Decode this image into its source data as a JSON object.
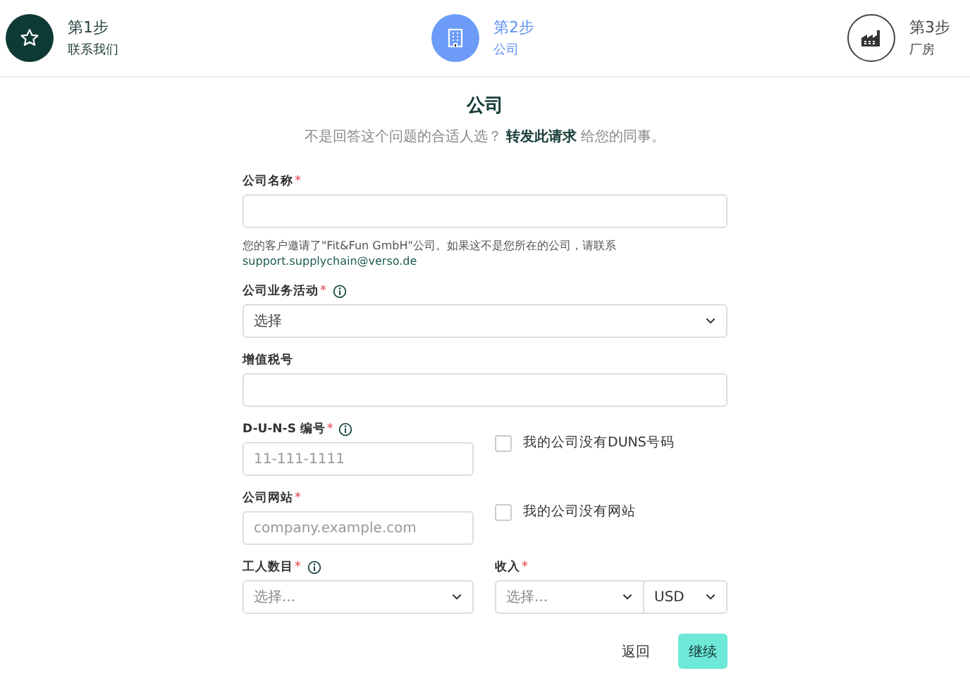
{
  "steps": [
    {
      "title": "第1步",
      "name": "联系我们",
      "completed": true,
      "selected": false
    },
    {
      "title": "第2步",
      "name": "公司",
      "completed": false,
      "selected": true
    },
    {
      "title": "第3步",
      "name": "厂房",
      "completed": false,
      "selected": false
    }
  ],
  "form": {
    "title": "公司",
    "subtitle": {
      "before": "不是回答这个问题的合适人选？",
      "link": "转发此请求",
      "after": "给您的同事。"
    },
    "fields": [
      {
        "kind": "text",
        "label": "公司名称",
        "required_mark": "*",
        "info": false,
        "note": "您的客户邀请了\"Fit&Fun GmbH\"公司。如果这不是您所在的公司，请联系",
        "note_link": "support.supplychain@verso.de"
      },
      {
        "kind": "select",
        "label": "公司业务活动",
        "required_mark": "*",
        "info": true,
        "value": "选择"
      },
      {
        "kind": "text",
        "label": "增值税号",
        "info": false
      },
      {
        "kind": "text_check",
        "label": "D-U-N-S 编号",
        "required_mark": "*",
        "info": true,
        "placeholder": "11-111-1111",
        "checkbox": {
          "label": "我的公司没有DUNS号码",
          "checked": false
        }
      },
      {
        "kind": "text_check",
        "label": "公司网站",
        "required_mark": "*",
        "info": false,
        "placeholder": "company.example.com",
        "checkbox": {
          "label": "我的公司没有网站",
          "checked": false
        }
      },
      {
        "kind": "select_pair",
        "left": {
          "label": "工人数目",
          "required_mark": "*",
          "info": true,
          "placeholder": "选择..."
        },
        "right": {
          "label": "收入",
          "required_mark": "*",
          "info": false,
          "placeholder": "选择...",
          "currency": "USD"
        }
      }
    ],
    "back": "返回",
    "continue": "继续"
  }
}
